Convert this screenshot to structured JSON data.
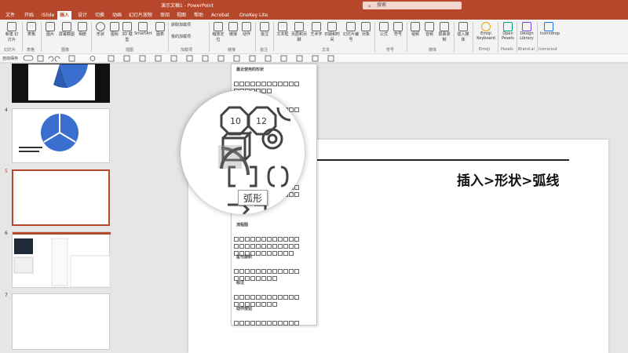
{
  "window": {
    "title": "演示文稿1 - PowerPoint"
  },
  "search": {
    "placeholder": "搜索"
  },
  "tabs": [
    "文件",
    "开始",
    "iSlide",
    "插入",
    "设计",
    "切换",
    "动画",
    "幻灯片放映",
    "审阅",
    "视图",
    "帮助",
    "Acrobat",
    "OneKey Lite"
  ],
  "active_tab": "插入",
  "ribbon": {
    "buttons": [
      {
        "label": "新建\n幻灯片"
      },
      {
        "label": "表格"
      },
      {
        "label": "图片"
      },
      {
        "label": "屏幕截图"
      },
      {
        "label": "相册"
      },
      {
        "label": "形状"
      },
      {
        "label": "图标"
      },
      {
        "label": "3D\n模型"
      },
      {
        "label": "SmartArt"
      },
      {
        "label": "图表"
      },
      {
        "label": "获取加载项"
      },
      {
        "label": "我的加载项"
      },
      {
        "label": "缩放定位"
      },
      {
        "label": "链接"
      },
      {
        "label": "动作"
      },
      {
        "label": "批注"
      },
      {
        "label": "文本框"
      },
      {
        "label": "页眉和页脚"
      },
      {
        "label": "艺术字"
      },
      {
        "label": "日期和时间"
      },
      {
        "label": "幻灯片编号"
      },
      {
        "label": "对象"
      },
      {
        "label": "公式"
      },
      {
        "label": "符号"
      },
      {
        "label": "视频"
      },
      {
        "label": "音频"
      },
      {
        "label": "屏幕录制"
      },
      {
        "label": "插入媒体"
      },
      {
        "label": "Emoji Keyboard"
      },
      {
        "label": "Open Pexels"
      },
      {
        "label": "Design Library"
      },
      {
        "label": "Iconndrop"
      }
    ],
    "groups": [
      "幻灯片",
      "表格",
      "图像",
      "插图",
      "加载项",
      "链接",
      "批注",
      "文本",
      "符号",
      "媒体",
      "Emoji",
      "Pexels",
      "Brand.ai",
      "Iconscout"
    ]
  },
  "qat": {
    "label": "自动保存"
  },
  "shapes_menu": {
    "sections": [
      "最近使用的形状",
      "线条",
      "流程图",
      "星与旗帜",
      "标注",
      "动作按钮"
    ]
  },
  "magnifier": {
    "labels": [
      "10",
      "12"
    ],
    "tooltip": "弧形"
  },
  "slides": {
    "numbers": [
      "4",
      "5",
      "6",
      "7"
    ],
    "selected": "5"
  },
  "slide": {
    "caption": "插入>形状>弧线"
  },
  "colors": {
    "accent": "#b7472a",
    "chart_blue": "#3a6fd0"
  }
}
